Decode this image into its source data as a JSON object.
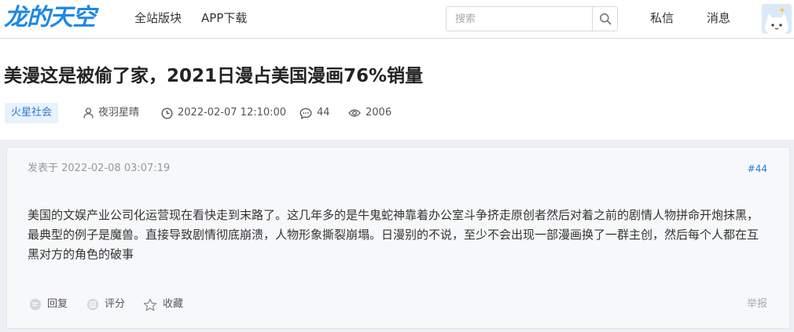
{
  "header": {
    "logo_text": "龙的天空",
    "nav": [
      "全站版块",
      "APP下载"
    ],
    "search_placeholder": "搜索",
    "messages_label": "私信",
    "notifications_label": "消息"
  },
  "thread": {
    "title": "美漫这是被偷了家，2021日漫占美国漫画76%销量",
    "category": "火星社会",
    "author": "夜羽星晴",
    "created_at": "2022-02-07 12:10:00",
    "reply_count": "44",
    "view_count": "2006"
  },
  "post": {
    "posted_at": "发表于 2022-02-08 03:07:19",
    "floor": "#44",
    "content": "美国的文娱产业公司化运营现在看快走到末路了。这几年多的是牛鬼蛇神靠着办公室斗争挤走原创者然后对着之前的剧情人物拼命开炮抹黑，最典型的例子是魔兽。直接导致剧情彻底崩溃，人物形象撕裂崩塌。日漫别的不说，至少不会出现一部漫画换了一群主创，然后每个人都在互黑对方的角色的破事",
    "actions": {
      "reply": "回复",
      "rate": "评分",
      "favorite": "收藏",
      "report": "举报"
    }
  },
  "colors": {
    "accent": "#2a7ad4",
    "logo": "#1e88e5",
    "page_bg": "#eceff4",
    "card_bg": "#f7f8fa"
  }
}
